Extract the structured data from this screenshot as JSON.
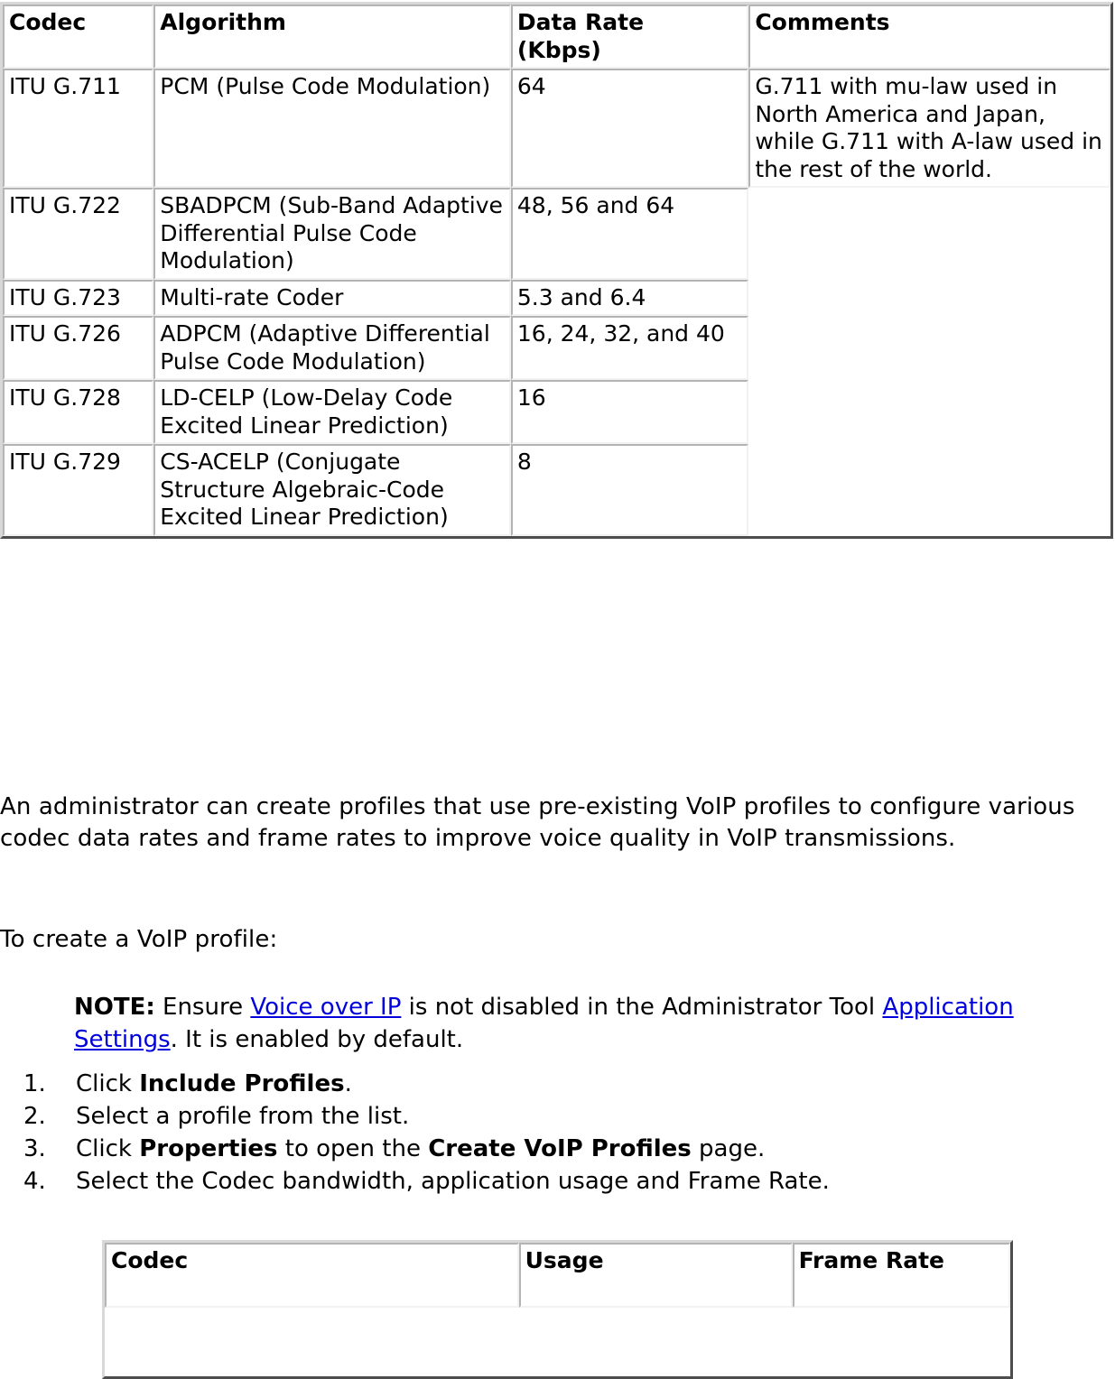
{
  "codec_table": {
    "name": "voip-codec-reference-table",
    "columns": [
      {
        "key": "codec",
        "label": "Codec"
      },
      {
        "key": "algorithm",
        "label": "Algorithm"
      },
      {
        "key": "rate",
        "label": "Data Rate (Kbps)"
      },
      {
        "key": "comments",
        "label": "Comments"
      }
    ],
    "header": {
      "codec": "Codec",
      "algorithm": "Algorithm",
      "rate_line1": "Data Rate",
      "rate_line2": "(Kbps)",
      "comments": "Comments"
    },
    "rows": [
      {
        "codec": "ITU G.711",
        "algorithm": "PCM (Pulse Code Modulation)",
        "rate": "64",
        "comments": "G.711 with mu-law used in North America and Japan, while G.711 with A-law used in the rest of the world."
      },
      {
        "codec": "ITU G.722",
        "algorithm": "SBADPCM (Sub-Band Adaptive Differential Pulse Code Modulation)",
        "rate": "48, 56 and 64",
        "comments": ""
      },
      {
        "codec": "ITU G.723",
        "algorithm": "Multi-rate Coder",
        "rate": "5.3 and 6.4",
        "comments": ""
      },
      {
        "codec": "ITU G.726",
        "algorithm": "ADPCM (Adaptive Differential Pulse Code Modulation)",
        "rate": "16, 24, 32, and 40",
        "comments": ""
      },
      {
        "codec": "ITU G.728",
        "algorithm": "LD-CELP (Low-Delay Code Excited Linear Prediction)",
        "rate": "16",
        "comments": ""
      },
      {
        "codec": "ITU G.729",
        "algorithm": "CS-ACELP (Conjugate Structure Algebraic-Code Excited Linear Prediction)",
        "rate": "8",
        "comments": ""
      }
    ]
  },
  "intro": {
    "paragraph": "An administrator can create profiles that use pre-existing VoIP profiles to configure various codec data rates and frame rates to improve voice quality in VoIP transmissions."
  },
  "howto": {
    "lead": "To create a VoIP profile:"
  },
  "note": {
    "label": "NOTE:",
    "text_before_link1": " Ensure ",
    "link1": "Voice over IP",
    "text_between_links": " is not disabled in the Administrator Tool ",
    "link2": "Application Settings",
    "text_after_link2": ". It is enabled by default."
  },
  "steps": [
    {
      "number": "1.",
      "pre": "Click ",
      "bold1": "Include Profiles",
      "mid": "",
      "bold2": "",
      "post": "."
    },
    {
      "number": "2.",
      "pre": "Select a profile from the list.",
      "bold1": "",
      "mid": "",
      "bold2": "",
      "post": ""
    },
    {
      "number": "3.",
      "pre": "Click ",
      "bold1": "Properties",
      "mid": " to open the ",
      "bold2": "Create VoIP Profiles",
      "post": " page."
    },
    {
      "number": "4.",
      "pre": "Select the Codec bandwidth, application usage and Frame Rate.",
      "bold1": "",
      "mid": "",
      "bold2": "",
      "post": ""
    }
  ],
  "profiles_table": {
    "name": "create-voip-profiles-table",
    "header": {
      "codec": "Codec",
      "usage": "Usage",
      "frame_rate": "Frame Rate"
    },
    "rows": []
  },
  "colors": {
    "link": "#0000dd",
    "text": "#000000",
    "table_border_light": "#d8d8d8",
    "table_border_dark": "#4d4d4d",
    "cell_border": "#b4b4b4",
    "page_background": "#ffffff"
  }
}
